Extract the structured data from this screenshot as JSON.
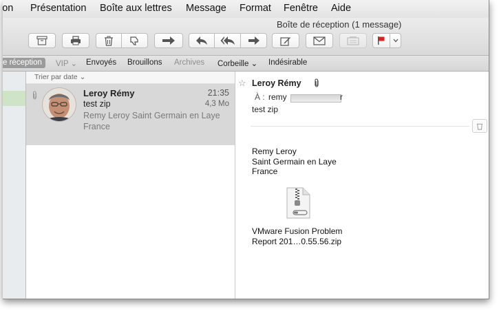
{
  "menubar": {
    "items": [
      "ion",
      "Présentation",
      "Boîte aux lettres",
      "Message",
      "Format",
      "Fenêtre",
      "Aide"
    ]
  },
  "window": {
    "title": "Boîte de réception (1 message)"
  },
  "toolbar": {
    "buttons": [
      {
        "name": "archive",
        "icon": "archive-icon"
      },
      {
        "name": "print",
        "icon": "printer-icon"
      },
      {
        "name": "delete",
        "icon": "trash-icon"
      },
      {
        "name": "junk",
        "icon": "thumbs-down-icon"
      },
      {
        "name": "move",
        "icon": "move-arrow-icon"
      },
      {
        "name": "reply",
        "icon": "reply-icon"
      },
      {
        "name": "reply-all",
        "icon": "reply-all-icon"
      },
      {
        "name": "forward",
        "icon": "forward-icon"
      },
      {
        "name": "compose",
        "icon": "compose-icon"
      },
      {
        "name": "get-mail",
        "icon": "envelope-icon"
      },
      {
        "name": "note",
        "icon": "note-icon"
      },
      {
        "name": "flag",
        "icon": "flag-icon"
      }
    ],
    "flag_color": "#e02020"
  },
  "favorites": {
    "inbox": "e réception",
    "vip": "VIP",
    "sent": "Envoyés",
    "drafts": "Brouillons",
    "archives": "Archives",
    "trash": "Corbeille",
    "junk": "Indésirable"
  },
  "message_list": {
    "sort_label": "Trier par date",
    "messages": [
      {
        "sender": "Leroy Rémy",
        "time": "21:35",
        "subject": "test zip",
        "size": "4,3 Mo",
        "preview": "Remy Leroy Saint Germain en Laye France"
      }
    ]
  },
  "reading_pane": {
    "sender": "Leroy Rémy",
    "to_label": "À :",
    "to_value_start": "remy",
    "to_value_end": "r",
    "subject": "test zip",
    "body_lines": [
      "Remy Leroy",
      "Saint Germain en Laye",
      "France"
    ],
    "attachment_lines": [
      "VMware Fusion Problem",
      "Report 201…0.55.56.zip"
    ]
  },
  "colors": {
    "selected_row": "#d8d8d8",
    "sidebar_selection": "#cfe4c6"
  }
}
